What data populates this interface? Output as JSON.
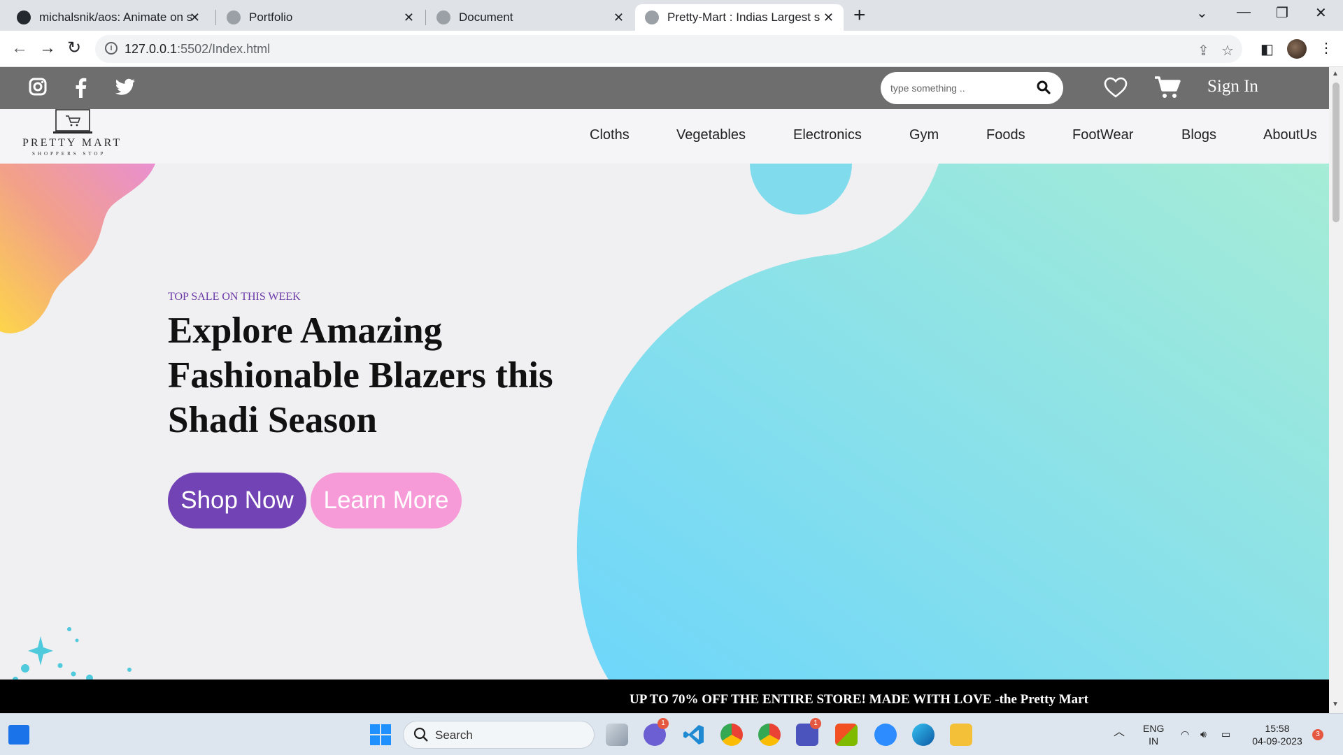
{
  "browser": {
    "tabs": [
      {
        "title": "michalsnik/aos: Animate on scroll"
      },
      {
        "title": "Portfolio"
      },
      {
        "title": "Document"
      },
      {
        "title": "Pretty-Mart : Indias Largest shopping"
      }
    ],
    "url_host": "127.0.0.1",
    "url_rest": ":5502/Index.html"
  },
  "topbar": {
    "search_placeholder": "type something ..",
    "signin_label": "Sign In"
  },
  "logo": {
    "name": "PRETTY MART",
    "subtitle": "SHOPPERS STOP"
  },
  "nav": {
    "items": [
      "Cloths",
      "Vegetables",
      "Electronics",
      "Gym",
      "Foods",
      "FootWear",
      "Blogs",
      "AboutUs"
    ]
  },
  "hero": {
    "tagline": "TOP SALE ON THIS WEEK",
    "headline": "Explore Amazing Fashionable Blazers this Shadi Season",
    "shop_button": "Shop Now",
    "learn_button": "Learn More",
    "colors": {
      "primary": "#7243b4",
      "secondary": "#f69bd8",
      "blob_start": "#6ed6fb",
      "blob_end": "#a6ecd6"
    }
  },
  "marquee": {
    "text": "UP TO 70% OFF THE ENTIRE STORE! MADE WITH LOVE -the Pretty Mart"
  },
  "taskbar": {
    "search_label": "Search",
    "language": "ENG",
    "region": "IN",
    "time": "15:58",
    "date": "04-09-2023",
    "teams_badge": "1",
    "teams2_badge": "1",
    "notifications": "3"
  }
}
